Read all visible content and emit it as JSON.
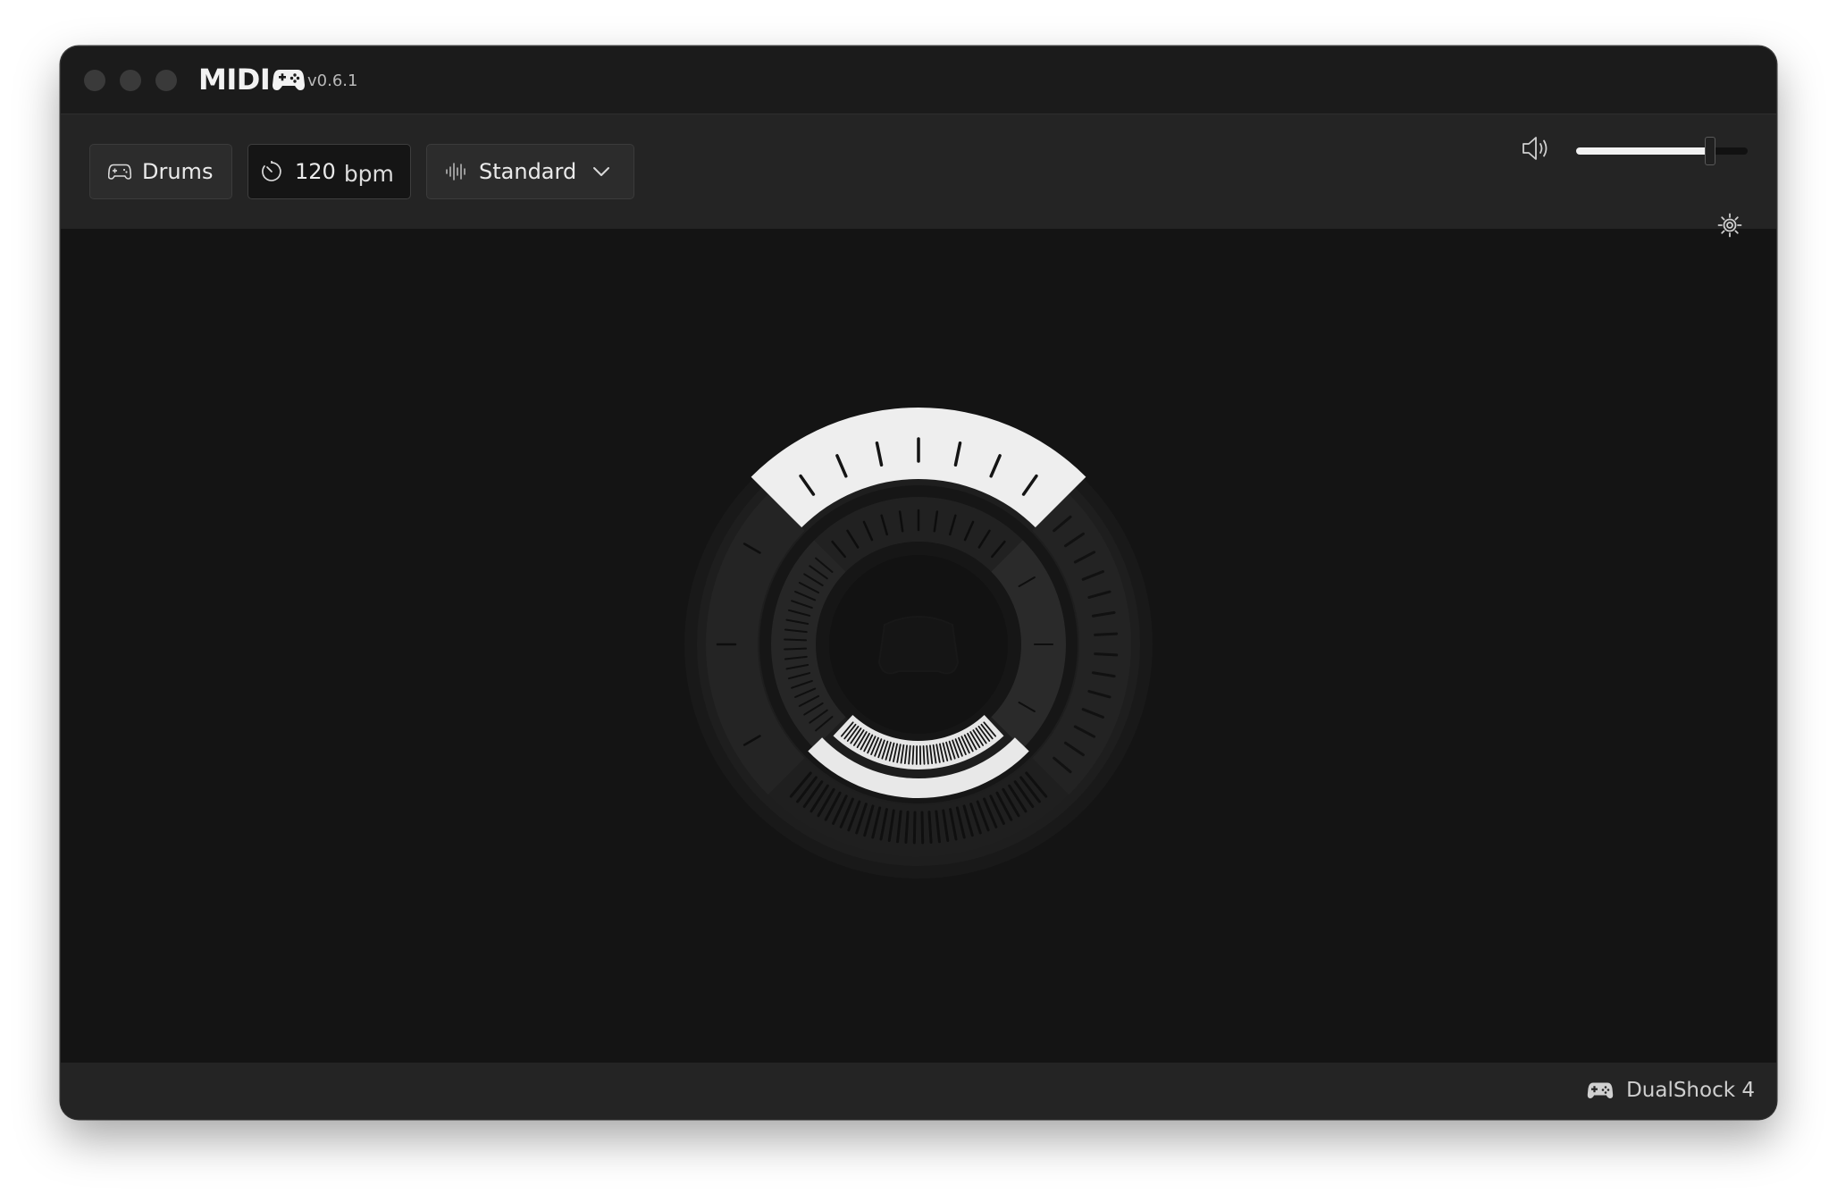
{
  "app": {
    "name": "MIDI",
    "version": "v0.6.1"
  },
  "toolbar": {
    "instrument_label": "Drums",
    "tempo_value": "120",
    "tempo_unit": "bpm",
    "scale_label": "Standard",
    "volume_level": 0.78
  },
  "status": {
    "device_label": "DualShock 4"
  },
  "colors": {
    "background": "#141414",
    "toolbar": "#242424",
    "accent": "#eaeaea"
  },
  "icons": {
    "instrument": "gamepad-icon",
    "tempo": "metronome-icon",
    "scale": "waveform-icon",
    "dropdown": "chevron-down-icon",
    "volume": "speaker-icon",
    "settings": "gear-icon",
    "device": "gamepad-icon"
  }
}
